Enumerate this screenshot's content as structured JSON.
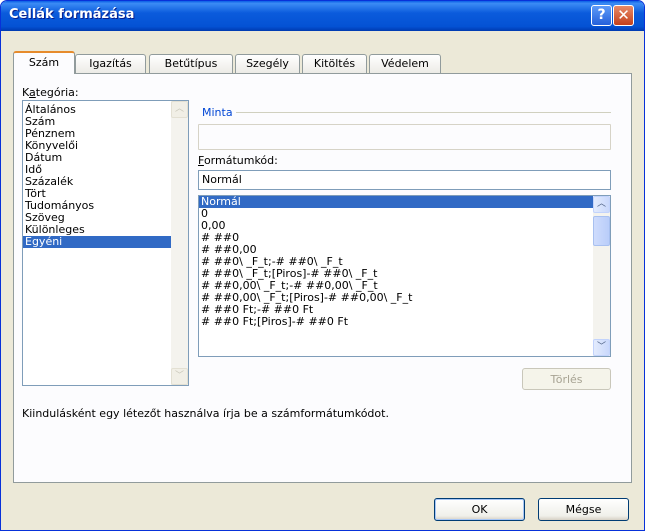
{
  "window": {
    "title": "Cellák formázása",
    "help_glyph": "?",
    "close_glyph": "✕"
  },
  "tabs": [
    "Szám",
    "Igazítás",
    "Betűtípus",
    "Szegély",
    "Kitöltés",
    "Védelem"
  ],
  "category": {
    "label_first": "K",
    "label_underlined": "a",
    "label_rest": "tegória:",
    "items": [
      "Általános",
      "Szám",
      "Pénznem",
      "Könyvelői",
      "Dátum",
      "Idő",
      "Százalék",
      "Tört",
      "Tudományos",
      "Szöveg",
      "Különleges",
      "Egyéni"
    ],
    "selected": "Egyéni"
  },
  "sample": {
    "label": "Minta",
    "value": ""
  },
  "format_code": {
    "label_underlined": "F",
    "label_rest": "ormátumkód:",
    "value": "Normál",
    "items": [
      "Normál",
      "0",
      "0,00",
      "# ##0",
      "# ##0,00",
      "# ##0\\ _F_t;-# ##0\\ _F_t",
      "# ##0\\ _F_t;[Piros]-# ##0\\ _F_t",
      "# ##0,00\\ _F_t;-# ##0,00\\ _F_t",
      "# ##0,00\\ _F_t;[Piros]-# ##0,00\\ _F_t",
      "# ##0 Ft;-# ##0 Ft",
      "# ##0 Ft;[Piros]-# ##0 Ft"
    ],
    "selected": "Normál"
  },
  "buttons": {
    "delete": "Törlés",
    "ok": "OK",
    "cancel": "Mégse"
  },
  "hint": "Kiindulásként egy létezőt használva írja be a számformátumkódot.",
  "icons": {
    "scroll_up": "▲",
    "scroll_down": "▼",
    "scroll_up_glyph": "︿",
    "scroll_down_glyph": "﹀"
  }
}
